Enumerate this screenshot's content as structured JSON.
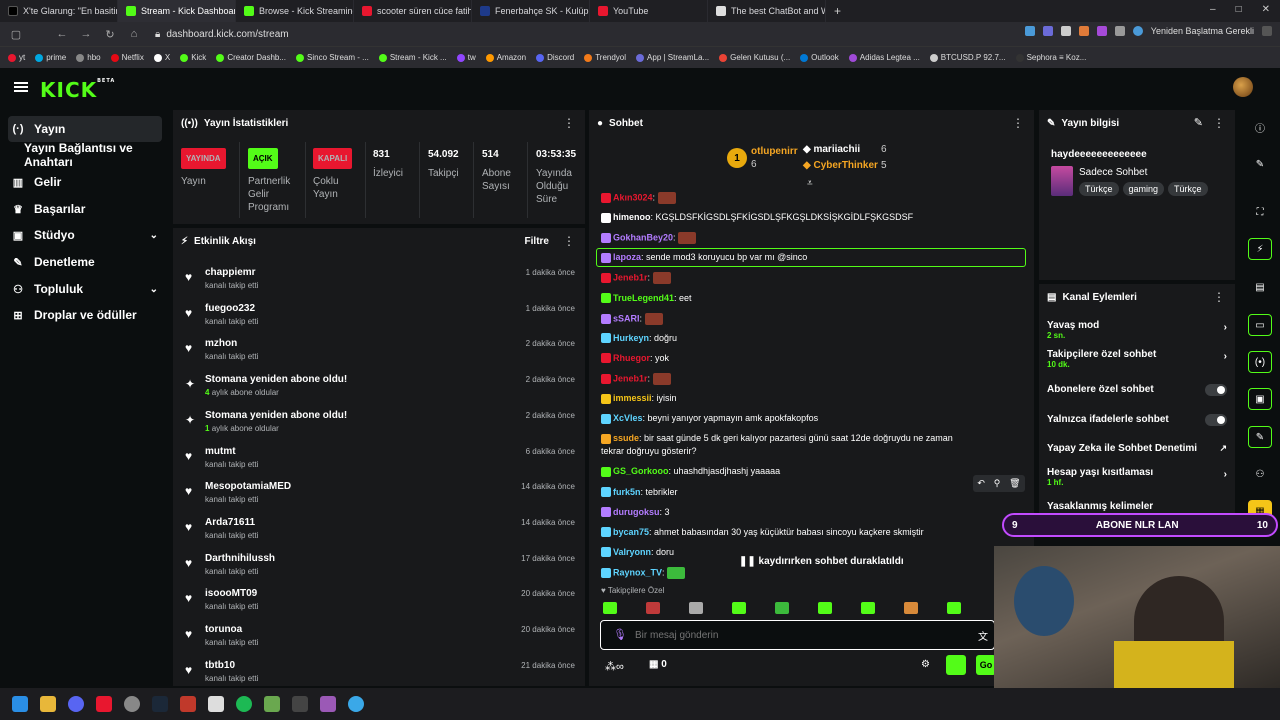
{
  "browser": {
    "tabs": [
      {
        "title": "X'te Glarung: \"En basitinde"
      },
      {
        "title": "Stream - Kick Dashboard"
      },
      {
        "title": "Browse - Kick Streaming"
      },
      {
        "title": "scooter süren cüce fatih ter"
      },
      {
        "title": "Fenerbahçe SK - Kulüp pre"
      },
      {
        "title": "YouTube"
      },
      {
        "title": "The best ChatBot and Widg"
      }
    ],
    "url": "dashboard.kick.com/stream",
    "restart_label": "Yeniden Başlatma Gerekli",
    "bookmarks": [
      "yt",
      "prime",
      "hbo",
      "Netflix",
      "X",
      "Kick",
      "Creator Dashb...",
      "Sinco Stream - ...",
      "Stream - Kick ...",
      "tw",
      "Amazon",
      "Discord",
      "Trendyol",
      "App | StreamLa...",
      "Gelen Kutusu (...",
      "Outlook",
      "Adidas Legtea ...",
      "BTCUSD.P 92.7...",
      "Sephora ≡ Koz..."
    ]
  },
  "brand": {
    "logo": "KICK",
    "beta": "BETA"
  },
  "sidebar": {
    "items": [
      {
        "label": "Yayın",
        "icon": "broadcast-icon"
      },
      {
        "label": "Yayın Bağlantısı ve Anahtarı"
      },
      {
        "label": "Gelir",
        "icon": "chart-icon"
      },
      {
        "label": "Başarılar",
        "icon": "trophy-icon"
      },
      {
        "label": "Stüdyo",
        "icon": "studio-icon"
      },
      {
        "label": "Denetleme",
        "icon": "wrench-icon"
      },
      {
        "label": "Topluluk",
        "icon": "community-icon"
      },
      {
        "label": "Droplar ve ödüller",
        "icon": "gift-icon"
      }
    ]
  },
  "stats": {
    "title": "Yayın İstatistikleri",
    "items": [
      {
        "value": "YAYINDA",
        "label": "Yayın",
        "color": "#e8172f"
      },
      {
        "value": "AÇIK",
        "label": "Partnerlik Gelir Programı",
        "color": "#53fc18"
      },
      {
        "value": "KAPALI",
        "label": "Çoklu Yayın",
        "color": "#e8172f"
      },
      {
        "value": "831",
        "label": "İzleyici"
      },
      {
        "value": "54.092",
        "label": "Takipçi"
      },
      {
        "value": "514",
        "label": "Abone Sayısı"
      },
      {
        "value": "03:53:35",
        "label": "Yayında Olduğu Süre"
      }
    ]
  },
  "activity": {
    "title": "Etkinlik Akışı",
    "filter": "Filtre",
    "rows": [
      {
        "name": "chappiemr",
        "sub": "kanalı takip etti",
        "time": "1 dakika önce",
        "type": "follow"
      },
      {
        "name": "fuegoo232",
        "sub": "kanalı takip etti",
        "time": "1 dakika önce",
        "type": "follow"
      },
      {
        "name": "mzhon",
        "sub": "kanalı takip etti",
        "time": "2 dakika önce",
        "type": "follow"
      },
      {
        "name": "Stomana yeniden abone oldu!",
        "sub_count": "4",
        "sub": "aylık abone oldular",
        "time": "2 dakika önce",
        "type": "sub"
      },
      {
        "name": "Stomana yeniden abone oldu!",
        "sub_count": "1",
        "sub": "aylık abone oldular",
        "time": "2 dakika önce",
        "type": "sub"
      },
      {
        "name": "mutmt",
        "sub": "kanalı takip etti",
        "time": "6 dakika önce",
        "type": "follow"
      },
      {
        "name": "MesopotamiaMED",
        "sub": "kanalı takip etti",
        "time": "14 dakika önce",
        "type": "follow"
      },
      {
        "name": "Arda71611",
        "sub": "kanalı takip etti",
        "time": "14 dakika önce",
        "type": "follow"
      },
      {
        "name": "Darthnihilussh",
        "sub": "kanalı takip etti",
        "time": "17 dakika önce",
        "type": "follow"
      },
      {
        "name": "isoooMT09",
        "sub": "kanalı takip etti",
        "time": "20 dakika önce",
        "type": "follow"
      },
      {
        "name": "torunoa",
        "sub": "kanalı takip etti",
        "time": "20 dakika önce",
        "type": "follow"
      },
      {
        "name": "tbtb10",
        "sub": "kanalı takip etti",
        "time": "21 dakika önce",
        "type": "follow"
      }
    ]
  },
  "chat": {
    "title": "Sohbet",
    "leaders": [
      {
        "rank": "1",
        "name": "otlupenirr",
        "count": "6",
        "color": "#f5a623"
      },
      {
        "name": "mariiachii",
        "count": "6",
        "color": "#ffffff"
      },
      {
        "name": "CyberThinker",
        "count": "5",
        "color": "#f5a623"
      }
    ],
    "messages": [
      {
        "user": "Akın3024",
        "color": "#e8172f",
        "text": ""
      },
      {
        "user": "himenoo",
        "color": "#ffffff",
        "text": "KGŞLDSFKİGSDLŞFKİGSDLŞFKGŞLDKSİŞKGİDLFŞKGSDSF"
      },
      {
        "user": "GokhanBey20",
        "color": "#b37cff",
        "text": ""
      },
      {
        "user": "lapoza",
        "color": "#b37cff",
        "text": "sende mod3 koruyucu bp var mı @sinco"
      },
      {
        "user": "Jeneb1r",
        "color": "#e8172f",
        "text": ""
      },
      {
        "user": "TrueLegend41",
        "color": "#53fc18",
        "text": "eet"
      },
      {
        "user": "sSARI",
        "color": "#b37cff",
        "text": ""
      },
      {
        "user": "Hurkeyn",
        "color": "#5ed4ff",
        "text": "doğru"
      },
      {
        "user": "Rhuegor",
        "color": "#e8172f",
        "text": "yok"
      },
      {
        "user": "Jeneb1r",
        "color": "#e8172f",
        "text": ""
      },
      {
        "user": "immessii",
        "color": "#f5c518",
        "text": "iyisin"
      },
      {
        "user": "XcVles",
        "color": "#5ed4ff",
        "text": "beyni yanıyor yapmayın amk apokfakopfos"
      },
      {
        "user": "ssude",
        "color": "#f5a623",
        "text": "bir saat günde 5 dk geri kalıyor pazartesi günü saat 12de doğruydu ne zaman"
      },
      {
        "user": "",
        "color": "#ffffff",
        "text": "tekrar doğruyu gösterir?"
      },
      {
        "user": "GS_Gorkooo",
        "color": "#53fc18",
        "text": "uhashdhjasdjhashj yaaaaa"
      },
      {
        "user": "furk5n",
        "color": "#5ed4ff",
        "text": "tebrikler"
      },
      {
        "user": "durugoksu",
        "color": "#b37cff",
        "text": "3"
      },
      {
        "user": "bycan75",
        "color": "#5ed4ff",
        "text": "ahmet babasından 30 yaş küçüktür babası sincoyu kaçkere skmiştir"
      },
      {
        "user": "Valryonn",
        "color": "#5ed4ff",
        "text": "doru"
      },
      {
        "user": "Raynox_TV",
        "color": "#5ed4ff",
        "text": ""
      }
    ],
    "paused": "kaydırırken sohbet duraklatıldı",
    "followers_only": "Takipçilere Özel",
    "placeholder": "Bir mesaj gönderin",
    "count": "0",
    "send": "Go"
  },
  "info": {
    "title": "Yayın bilgisi",
    "stream_title": "haydeeeeeeeeeeeee",
    "category": "Sadece Sohbet",
    "tags": [
      "Türkçe",
      "gaming",
      "Türkçe"
    ]
  },
  "channel_actions": {
    "title": "Kanal Eylemleri",
    "items": [
      {
        "label": "Yavaş mod",
        "sub": "2 sn."
      },
      {
        "label": "Takipçilere özel sohbet",
        "sub": "10 dk."
      },
      {
        "label": "Abonelere özel sohbet"
      },
      {
        "label": "Yalnızca ifadelerle sohbet"
      },
      {
        "label": "Yapay Zeka ile Sohbet Denetimi"
      },
      {
        "label": "Hesap yaşı kısıtlaması",
        "sub": "1 hf."
      },
      {
        "label": "Yasaklanmış kelimeler"
      }
    ]
  },
  "overlay": {
    "left": "9",
    "text": "ABONE NLR LAN",
    "right": "10"
  }
}
